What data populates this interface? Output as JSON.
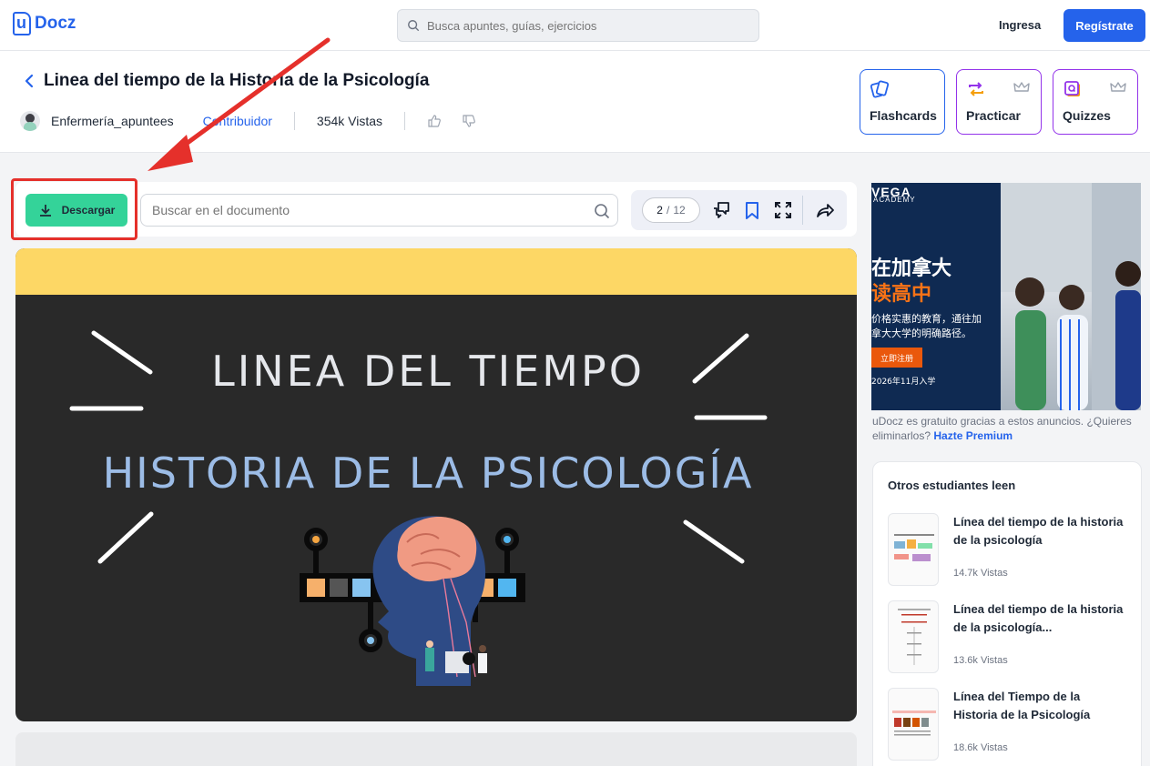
{
  "brand": {
    "name": "Docz"
  },
  "topbar": {
    "search_placeholder": "Busca apuntes, guías, ejercicios",
    "login_label": "Ingresa",
    "signup_label": "Regístrate"
  },
  "document": {
    "title": "Linea del tiempo de la Historia de la Psicología",
    "author": "Enfermería_apuntees",
    "role": "Contribuidor",
    "views": "354k Vistas"
  },
  "actions": [
    {
      "label": "Flashcards",
      "icon": "flashcards-icon",
      "premium": false
    },
    {
      "label": "Practicar",
      "icon": "practice-icon",
      "premium": true
    },
    {
      "label": "Quizzes",
      "icon": "quizzes-icon",
      "premium": true
    }
  ],
  "viewer": {
    "download_label": "Descargar",
    "search_placeholder": "Buscar en el documento",
    "page_current": "2",
    "page_total": "12"
  },
  "slide": {
    "line1": "LINEA DEL TIEMPO",
    "line2": "HISTORIA DE LA PSICOLOGÍA"
  },
  "ad": {
    "brand": "VEGA",
    "brand_sub": "ACADEMY",
    "headline1": "在加拿大",
    "headline2": "读高中",
    "body": "价格实惠的教育，通往加拿大大学的明确路径。",
    "cta": "立即注册",
    "date": "2026年11月入学"
  },
  "ad_note": {
    "text": "uDocz es gratuito gracias a estos anuncios. ¿Quieres eliminarlos?",
    "link": "Hazte Premium"
  },
  "others": {
    "title": "Otros estudiantes leen",
    "items": [
      {
        "title": "Línea del tiempo de la historia de la psicología",
        "views": "14.7k Vistas"
      },
      {
        "title": "Línea del tiempo de la historia de la psicología...",
        "views": "13.6k Vistas"
      },
      {
        "title": "Línea del Tiempo de la Historia de la Psicología",
        "views": "18.6k Vistas"
      }
    ]
  },
  "colors": {
    "primary": "#2563eb",
    "download": "#34d399",
    "premium": "#9333ea",
    "highlight": "#e5302b",
    "slide_band": "#fdd765",
    "slide_bg": "#292929"
  }
}
